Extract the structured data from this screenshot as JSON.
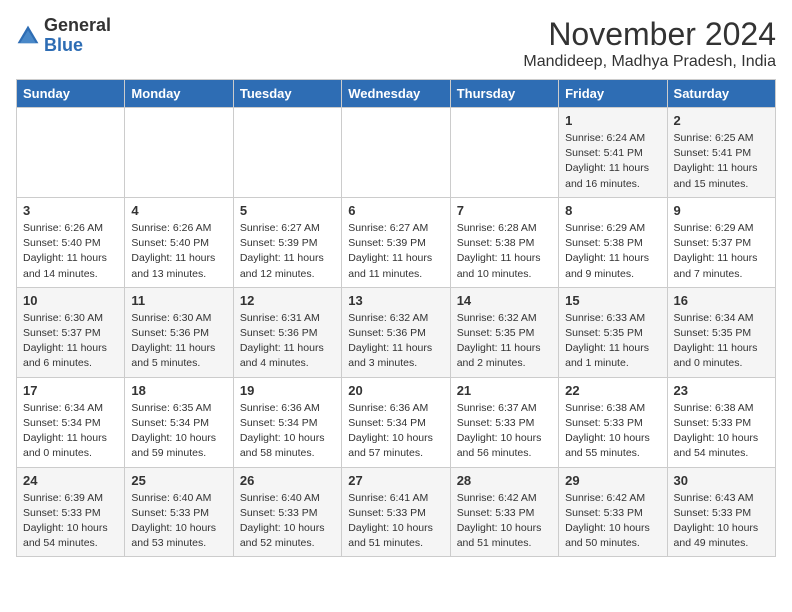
{
  "header": {
    "logo_general": "General",
    "logo_blue": "Blue",
    "month_title": "November 2024",
    "location": "Mandideep, Madhya Pradesh, India"
  },
  "weekdays": [
    "Sunday",
    "Monday",
    "Tuesday",
    "Wednesday",
    "Thursday",
    "Friday",
    "Saturday"
  ],
  "weeks": [
    [
      {
        "day": "",
        "info": ""
      },
      {
        "day": "",
        "info": ""
      },
      {
        "day": "",
        "info": ""
      },
      {
        "day": "",
        "info": ""
      },
      {
        "day": "",
        "info": ""
      },
      {
        "day": "1",
        "info": "Sunrise: 6:24 AM\nSunset: 5:41 PM\nDaylight: 11 hours\nand 16 minutes."
      },
      {
        "day": "2",
        "info": "Sunrise: 6:25 AM\nSunset: 5:41 PM\nDaylight: 11 hours\nand 15 minutes."
      }
    ],
    [
      {
        "day": "3",
        "info": "Sunrise: 6:26 AM\nSunset: 5:40 PM\nDaylight: 11 hours\nand 14 minutes."
      },
      {
        "day": "4",
        "info": "Sunrise: 6:26 AM\nSunset: 5:40 PM\nDaylight: 11 hours\nand 13 minutes."
      },
      {
        "day": "5",
        "info": "Sunrise: 6:27 AM\nSunset: 5:39 PM\nDaylight: 11 hours\nand 12 minutes."
      },
      {
        "day": "6",
        "info": "Sunrise: 6:27 AM\nSunset: 5:39 PM\nDaylight: 11 hours\nand 11 minutes."
      },
      {
        "day": "7",
        "info": "Sunrise: 6:28 AM\nSunset: 5:38 PM\nDaylight: 11 hours\nand 10 minutes."
      },
      {
        "day": "8",
        "info": "Sunrise: 6:29 AM\nSunset: 5:38 PM\nDaylight: 11 hours\nand 9 minutes."
      },
      {
        "day": "9",
        "info": "Sunrise: 6:29 AM\nSunset: 5:37 PM\nDaylight: 11 hours\nand 7 minutes."
      }
    ],
    [
      {
        "day": "10",
        "info": "Sunrise: 6:30 AM\nSunset: 5:37 PM\nDaylight: 11 hours\nand 6 minutes."
      },
      {
        "day": "11",
        "info": "Sunrise: 6:30 AM\nSunset: 5:36 PM\nDaylight: 11 hours\nand 5 minutes."
      },
      {
        "day": "12",
        "info": "Sunrise: 6:31 AM\nSunset: 5:36 PM\nDaylight: 11 hours\nand 4 minutes."
      },
      {
        "day": "13",
        "info": "Sunrise: 6:32 AM\nSunset: 5:36 PM\nDaylight: 11 hours\nand 3 minutes."
      },
      {
        "day": "14",
        "info": "Sunrise: 6:32 AM\nSunset: 5:35 PM\nDaylight: 11 hours\nand 2 minutes."
      },
      {
        "day": "15",
        "info": "Sunrise: 6:33 AM\nSunset: 5:35 PM\nDaylight: 11 hours\nand 1 minute."
      },
      {
        "day": "16",
        "info": "Sunrise: 6:34 AM\nSunset: 5:35 PM\nDaylight: 11 hours\nand 0 minutes."
      }
    ],
    [
      {
        "day": "17",
        "info": "Sunrise: 6:34 AM\nSunset: 5:34 PM\nDaylight: 11 hours\nand 0 minutes."
      },
      {
        "day": "18",
        "info": "Sunrise: 6:35 AM\nSunset: 5:34 PM\nDaylight: 10 hours\nand 59 minutes."
      },
      {
        "day": "19",
        "info": "Sunrise: 6:36 AM\nSunset: 5:34 PM\nDaylight: 10 hours\nand 58 minutes."
      },
      {
        "day": "20",
        "info": "Sunrise: 6:36 AM\nSunset: 5:34 PM\nDaylight: 10 hours\nand 57 minutes."
      },
      {
        "day": "21",
        "info": "Sunrise: 6:37 AM\nSunset: 5:33 PM\nDaylight: 10 hours\nand 56 minutes."
      },
      {
        "day": "22",
        "info": "Sunrise: 6:38 AM\nSunset: 5:33 PM\nDaylight: 10 hours\nand 55 minutes."
      },
      {
        "day": "23",
        "info": "Sunrise: 6:38 AM\nSunset: 5:33 PM\nDaylight: 10 hours\nand 54 minutes."
      }
    ],
    [
      {
        "day": "24",
        "info": "Sunrise: 6:39 AM\nSunset: 5:33 PM\nDaylight: 10 hours\nand 54 minutes."
      },
      {
        "day": "25",
        "info": "Sunrise: 6:40 AM\nSunset: 5:33 PM\nDaylight: 10 hours\nand 53 minutes."
      },
      {
        "day": "26",
        "info": "Sunrise: 6:40 AM\nSunset: 5:33 PM\nDaylight: 10 hours\nand 52 minutes."
      },
      {
        "day": "27",
        "info": "Sunrise: 6:41 AM\nSunset: 5:33 PM\nDaylight: 10 hours\nand 51 minutes."
      },
      {
        "day": "28",
        "info": "Sunrise: 6:42 AM\nSunset: 5:33 PM\nDaylight: 10 hours\nand 51 minutes."
      },
      {
        "day": "29",
        "info": "Sunrise: 6:42 AM\nSunset: 5:33 PM\nDaylight: 10 hours\nand 50 minutes."
      },
      {
        "day": "30",
        "info": "Sunrise: 6:43 AM\nSunset: 5:33 PM\nDaylight: 10 hours\nand 49 minutes."
      }
    ]
  ]
}
